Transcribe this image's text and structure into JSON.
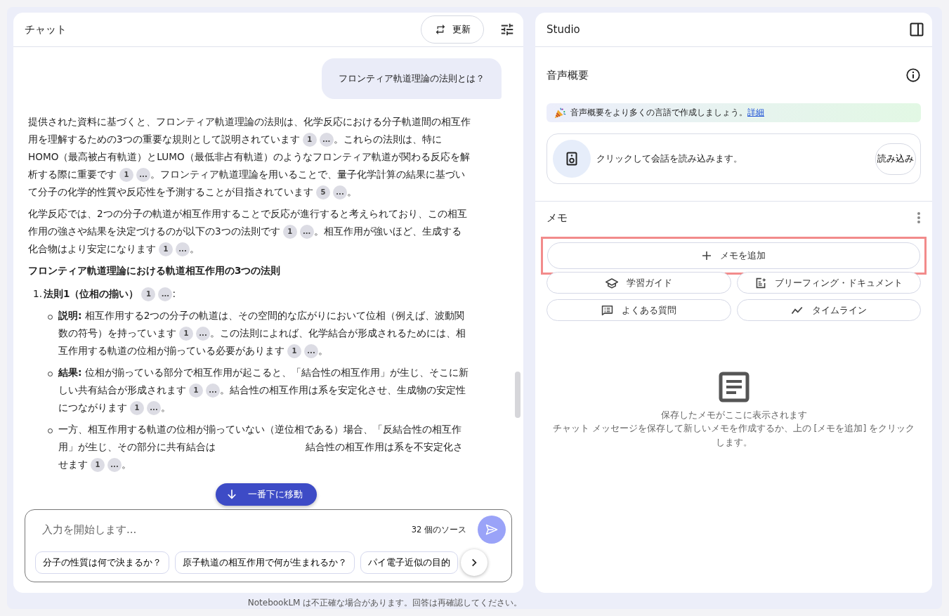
{
  "chat": {
    "title": "チャット",
    "refresh_label": "更新",
    "user_message": "フロンティア軌道理論の法則とは？",
    "answer": [
      {
        "kind": "para",
        "segments": [
          {
            "kind": "text",
            "text": "提供された資料に基づくと、フロンティア軌道理論の法則は、化学反応における分子軌道間の相互作用を理解するための3つの重要な規則として説明されています"
          },
          {
            "kind": "cite",
            "text": "1"
          },
          {
            "kind": "cite",
            "text": "..."
          },
          {
            "kind": "text",
            "text": "。これらの法則は、特にHOMO（最高被占有軌道）とLUMO（最低非占有軌道）のようなフロンティア軌道が関わる反応を解析する際に重要です"
          },
          {
            "kind": "cite",
            "text": "1"
          },
          {
            "kind": "cite",
            "text": "..."
          },
          {
            "kind": "text",
            "text": "。フロンティア軌道理論を用いることで、量子化学計算の結果に基づいて分子の化学的性質や反応性を予測することが目指されています"
          },
          {
            "kind": "cite",
            "text": "5"
          },
          {
            "kind": "cite",
            "text": "..."
          },
          {
            "kind": "text",
            "text": "。"
          }
        ]
      },
      {
        "kind": "para",
        "segments": [
          {
            "kind": "text",
            "text": "化学反応では、2つの分子の軌道が相互作用することで反応が進行すると考えられており、この相互作用の強さや結果を決定づけるのが以下の3つの法則です"
          },
          {
            "kind": "cite",
            "text": "1"
          },
          {
            "kind": "cite",
            "text": "..."
          },
          {
            "kind": "text",
            "text": "。相互作用が強いほど、生成する化合物はより安定になります"
          },
          {
            "kind": "cite",
            "text": "1"
          },
          {
            "kind": "cite",
            "text": "..."
          },
          {
            "kind": "text",
            "text": "。"
          }
        ]
      },
      {
        "kind": "heading",
        "text": "フロンティア軌道理論における軌道相互作用の3つの法則"
      },
      {
        "kind": "numbered",
        "marker": "1.",
        "segments": [
          {
            "kind": "text",
            "text": "**法則1（位相の揃い）**"
          },
          {
            "kind": "cite",
            "text": "1"
          },
          {
            "kind": "cite",
            "text": "..."
          },
          {
            "kind": "text",
            "text": ":"
          }
        ]
      },
      {
        "kind": "bullet",
        "segments": [
          {
            "kind": "text",
            "text": "**説明:** 相互作用する2つの分子の軌道は、その空間的な広がりにおいて位相（例えば、波動関数の符号）を持っています"
          },
          {
            "kind": "cite",
            "text": "1"
          },
          {
            "kind": "cite",
            "text": "..."
          },
          {
            "kind": "text",
            "text": "。この法則によれば、化学結合が形成されるためには、相互作用する軌道の位相が揃っている必要があります"
          },
          {
            "kind": "cite",
            "text": "1"
          },
          {
            "kind": "cite",
            "text": "..."
          },
          {
            "kind": "text",
            "text": "。"
          }
        ]
      },
      {
        "kind": "bullet",
        "segments": [
          {
            "kind": "text",
            "text": "**結果:** 位相が揃っている部分で相互作用が起こると、「結合性の相互作用」が生じ、そこに新しい共有結合が形成されます"
          },
          {
            "kind": "cite",
            "text": "1"
          },
          {
            "kind": "cite",
            "text": "..."
          },
          {
            "kind": "text",
            "text": "。結合性の相互作用は系を安定化させ、生成物の安定性につながります"
          },
          {
            "kind": "cite",
            "text": "1"
          },
          {
            "kind": "cite",
            "text": "..."
          },
          {
            "kind": "text",
            "text": "。"
          }
        ]
      },
      {
        "kind": "bullet",
        "segments": [
          {
            "kind": "text",
            "text": "一方、相互作用する軌道の位相が揃っていない（逆位相である）場合、「反結合性の相互作用」が生じ、その部分に共有結合は"
          },
          {
            "kind": "covered"
          },
          {
            "kind": "text",
            "text": "結合性の相互作用は系を不安定化させます"
          },
          {
            "kind": "cite",
            "text": "1"
          },
          {
            "kind": "cite",
            "text": "..."
          },
          {
            "kind": "text",
            "text": "。"
          }
        ]
      }
    ],
    "jump_label": "一番下に移動",
    "input": {
      "placeholder": "入力を開始します...",
      "source_count": "32 個のソース"
    },
    "suggestions": [
      "分子の性質は何で決まるか？",
      "原子軌道の相互作用で何が生まれるか？",
      "パイ電子近似の目的"
    ]
  },
  "disclaimer": "NotebookLM は不正確な場合があります。回答は再確認してください。",
  "studio": {
    "title": "Studio",
    "audio": {
      "title": "音声概要",
      "banner": "音声概要をより多くの言語で作成しましょう。",
      "banner_link": "詳細",
      "load_text": "クリックして会話を読み込みます。",
      "load_button": "読み込み"
    },
    "notes": {
      "title": "メモ",
      "add_label": "メモを追加",
      "add_highlighted": true,
      "tools": [
        {
          "kind": "guide",
          "label": "学習ガイド"
        },
        {
          "kind": "briefing",
          "label": "ブリーフィング・ドキュメント"
        },
        {
          "kind": "faq",
          "label": "よくある質問"
        },
        {
          "kind": "timeline",
          "label": "タイムライン"
        }
      ],
      "empty_title": "保存したメモがここに表示されます",
      "empty_text": "チャット メッセージを保存して新しいメモを作成するか、上の [メモを追加] をクリックします。"
    }
  }
}
